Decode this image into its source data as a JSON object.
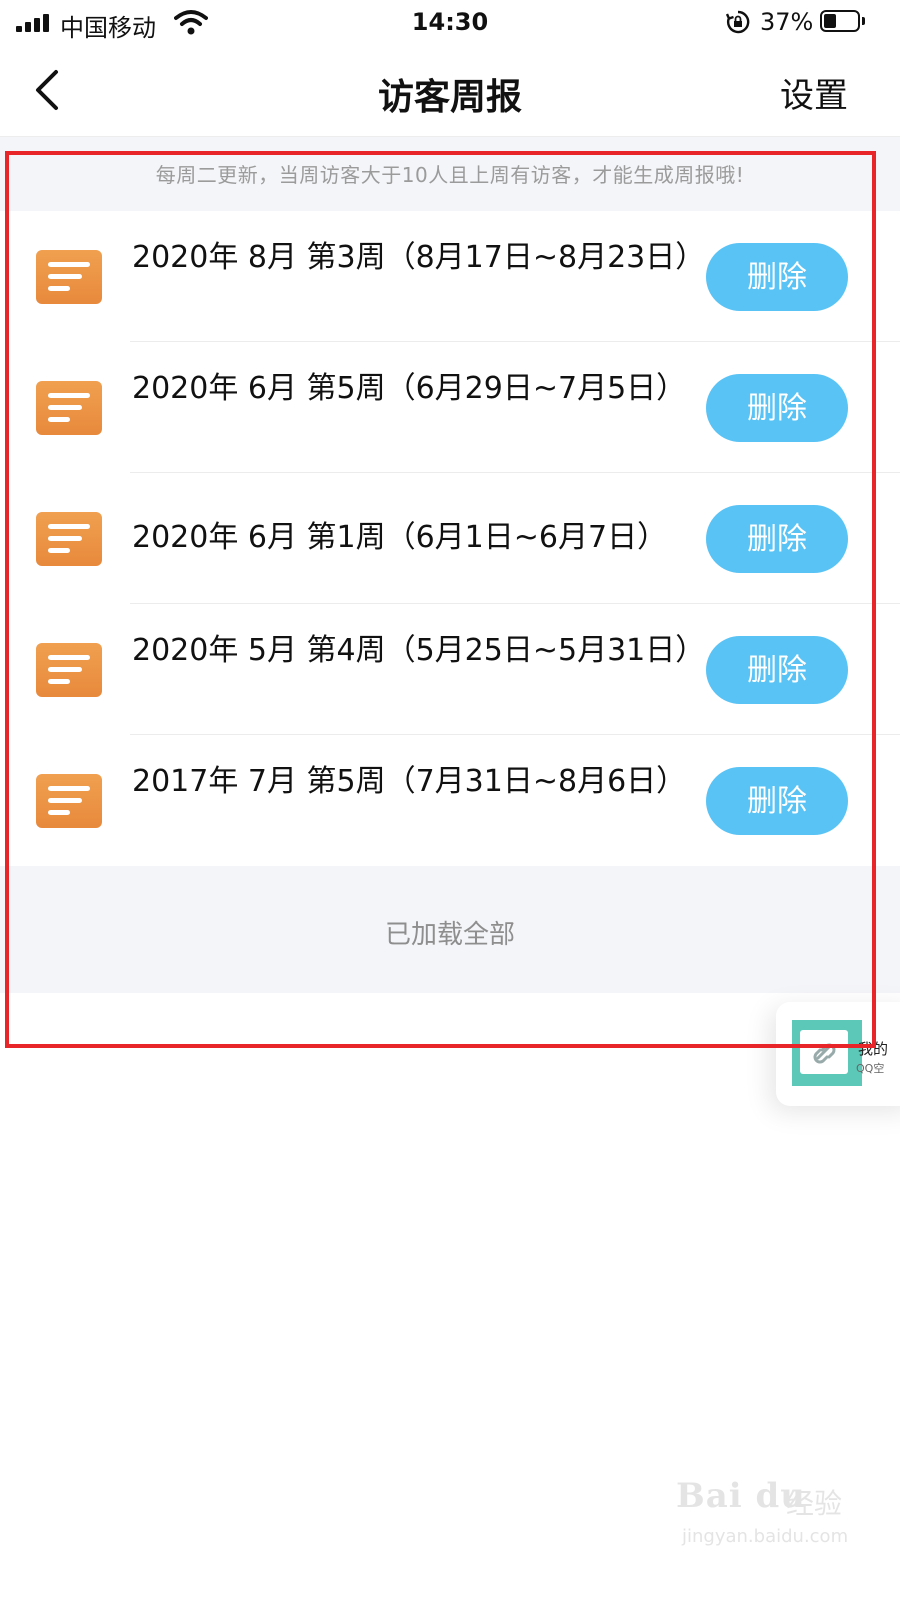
{
  "status_bar": {
    "carrier": "中国移动",
    "time": "14:30",
    "battery_percent": "37%",
    "battery_level": 0.37,
    "icons": [
      "signal-icon",
      "wifi-icon",
      "rotation-lock-icon",
      "battery-icon"
    ]
  },
  "nav": {
    "back_icon": "chevron-left-icon",
    "title": "访客周报",
    "settings_label": "设置"
  },
  "notice": {
    "text": "每周二更新，当周访客大于10人且上周有访客，才能生成周报哦!"
  },
  "reports": [
    {
      "title": "2020年 8月 第3周（8月17日~8月23日）",
      "delete_label": "删除",
      "icon": "report-document-icon"
    },
    {
      "title": "2020年 6月 第5周（6月29日~7月5日）",
      "delete_label": "删除",
      "icon": "report-document-icon"
    },
    {
      "title": "2020年 6月 第1周（6月1日~6月7日）",
      "delete_label": "删除",
      "icon": "report-document-icon"
    },
    {
      "title": "2020年 5月 第4周（5月25日~5月31日）",
      "delete_label": "删除",
      "icon": "report-document-icon"
    },
    {
      "title": "2017年 7月 第5周（7月31日~8月6日）",
      "delete_label": "删除",
      "icon": "report-document-icon"
    }
  ],
  "footer": {
    "text": "已加载全部"
  },
  "floating_card": {
    "line1": "我的",
    "line2": "QQ空",
    "icon": "link-icon"
  },
  "watermark": {
    "logo": "Bai du",
    "cn": "经验",
    "url": "jingyan.baidu.com"
  },
  "colors": {
    "accent_button": "#59c3f5",
    "icon_orange": "#e8893c",
    "annotation_red": "#e8262a",
    "background_gray": "#f4f5f8"
  }
}
